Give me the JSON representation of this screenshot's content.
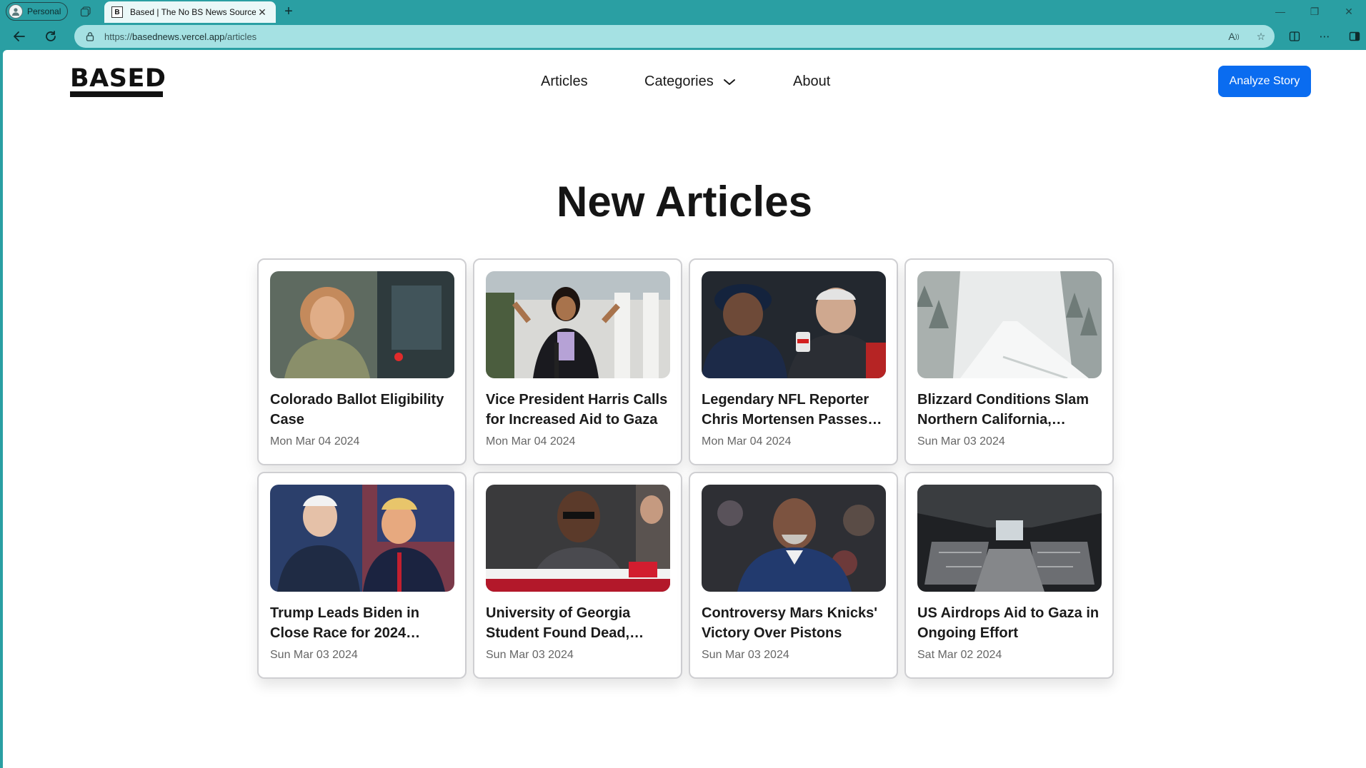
{
  "browser": {
    "profile_label": "Personal",
    "tab_title": "Based | The No BS News Source",
    "tab_favicon": "B",
    "url_prefix": "https://",
    "url_host": "basednews.vercel.app",
    "url_path": "/articles"
  },
  "site": {
    "logo": "BASED",
    "nav": {
      "articles": "Articles",
      "categories": "Categories",
      "about": "About"
    },
    "cta_label": "Analyze Story",
    "accent_color": "#0a6cf0"
  },
  "main": {
    "title": "New Articles",
    "articles": [
      {
        "title": "Colorado Ballot Eligibility Case",
        "date": "Mon Mar 04 2024"
      },
      {
        "title": "Vice President Harris Calls for Increased Aid to Gaza",
        "date": "Mon Mar 04 2024"
      },
      {
        "title": "Legendary NFL Reporter Chris Mortensen Passes…",
        "date": "Mon Mar 04 2024"
      },
      {
        "title": "Blizzard Conditions Slam Northern California,…",
        "date": "Sun Mar 03 2024"
      },
      {
        "title": "Trump Leads Biden in Close Race for 2024…",
        "date": "Sun Mar 03 2024"
      },
      {
        "title": "University of Georgia Student Found Dead,…",
        "date": "Sun Mar 03 2024"
      },
      {
        "title": "Controversy Mars Knicks' Victory Over Pistons",
        "date": "Sun Mar 03 2024"
      },
      {
        "title": "US Airdrops Aid to Gaza in Ongoing Effort",
        "date": "Sat Mar 02 2024"
      }
    ]
  }
}
